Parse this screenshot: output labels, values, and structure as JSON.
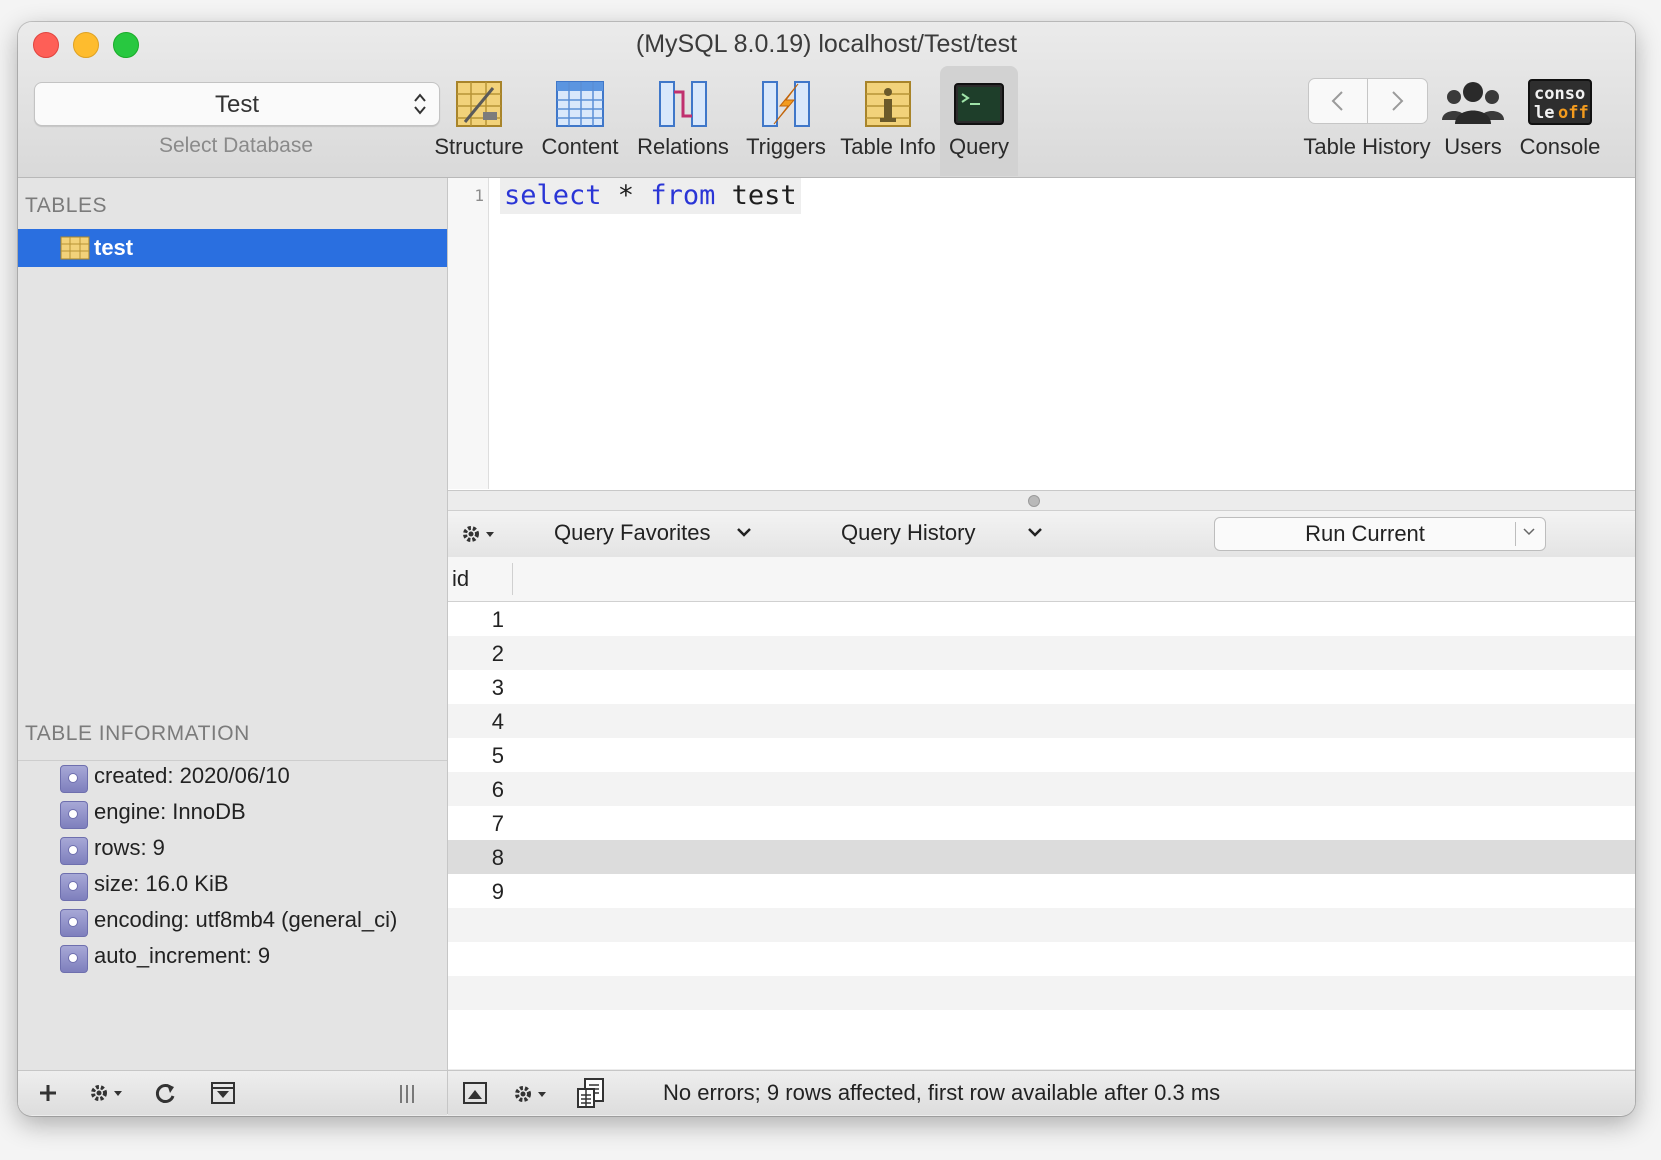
{
  "window": {
    "title": "(MySQL 8.0.19) localhost/Test/test"
  },
  "toolbar": {
    "database": {
      "value": "Test",
      "caption": "Select Database"
    },
    "items": [
      {
        "label": "Structure"
      },
      {
        "label": "Content"
      },
      {
        "label": "Relations"
      },
      {
        "label": "Triggers"
      },
      {
        "label": "Table Info"
      },
      {
        "label": "Query",
        "active": true
      }
    ],
    "history_label": "Table History",
    "users_label": "Users",
    "console_label": "Console",
    "console_icon_text": "conso le off"
  },
  "sidebar": {
    "tables_header": "TABLES",
    "tables": [
      {
        "name": "test",
        "selected": true
      }
    ],
    "info_header": "TABLE INFORMATION",
    "info": [
      "created: 2020/06/10",
      "engine: InnoDB",
      "rows: 9",
      "size: 16.0 KiB",
      "encoding: utf8mb4 (general_ci)",
      "auto_increment: 9"
    ]
  },
  "editor": {
    "line_number": "1",
    "tokens": {
      "select": "select",
      "star": " * ",
      "from": "from",
      "table": " test"
    }
  },
  "query_bar": {
    "favorites": "Query Favorites",
    "history": "Query History",
    "run": "Run Current"
  },
  "results": {
    "columns": [
      "id"
    ],
    "rows": [
      "1",
      "2",
      "3",
      "4",
      "5",
      "6",
      "7",
      "8",
      "9"
    ],
    "selected_row": "8"
  },
  "status": {
    "message": "No errors; 9 rows affected, first row available after 0.3 ms"
  },
  "colors": {
    "selection": "#2a6fe0",
    "keyword": "#2a35d6"
  }
}
